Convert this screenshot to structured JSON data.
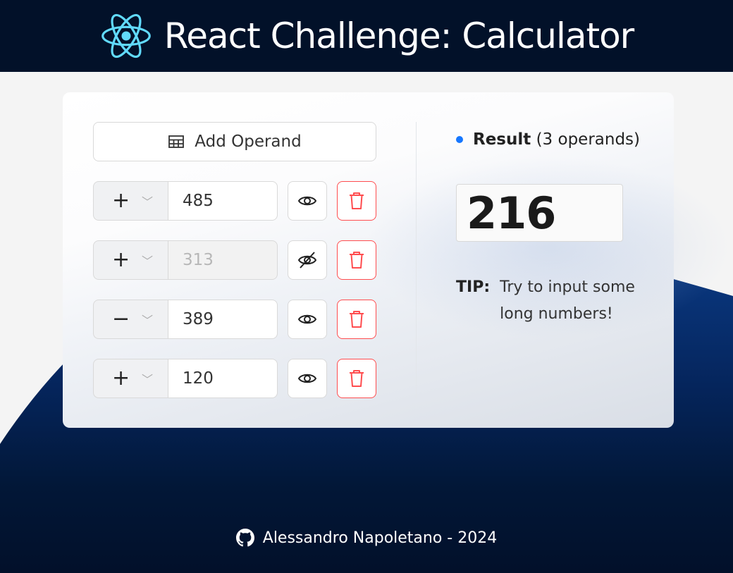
{
  "header": {
    "title": "React Challenge: Calculator",
    "logo_icon": "react-logo-icon"
  },
  "calculator": {
    "add_button_label": "Add Operand",
    "add_button_icon": "table-icon",
    "operands": [
      {
        "operator": "+",
        "value": "485",
        "visible": true
      },
      {
        "operator": "+",
        "value": "313",
        "visible": false
      },
      {
        "operator": "−",
        "value": "389",
        "visible": true
      },
      {
        "operator": "+",
        "value": "120",
        "visible": true
      }
    ]
  },
  "result": {
    "label": "Result",
    "count_text": "(3 operands)",
    "value": "216"
  },
  "tip": {
    "label": "TIP:",
    "text": "Try to input some long numbers!"
  },
  "footer": {
    "text": "Alessandro Napoletano - 2024",
    "icon": "github-icon"
  },
  "colors": {
    "header_bg": "#021129",
    "wave": "#0a3a82",
    "accent": "#1677ff",
    "danger": "#ff4d4f",
    "react_logo": "#61dafb"
  }
}
